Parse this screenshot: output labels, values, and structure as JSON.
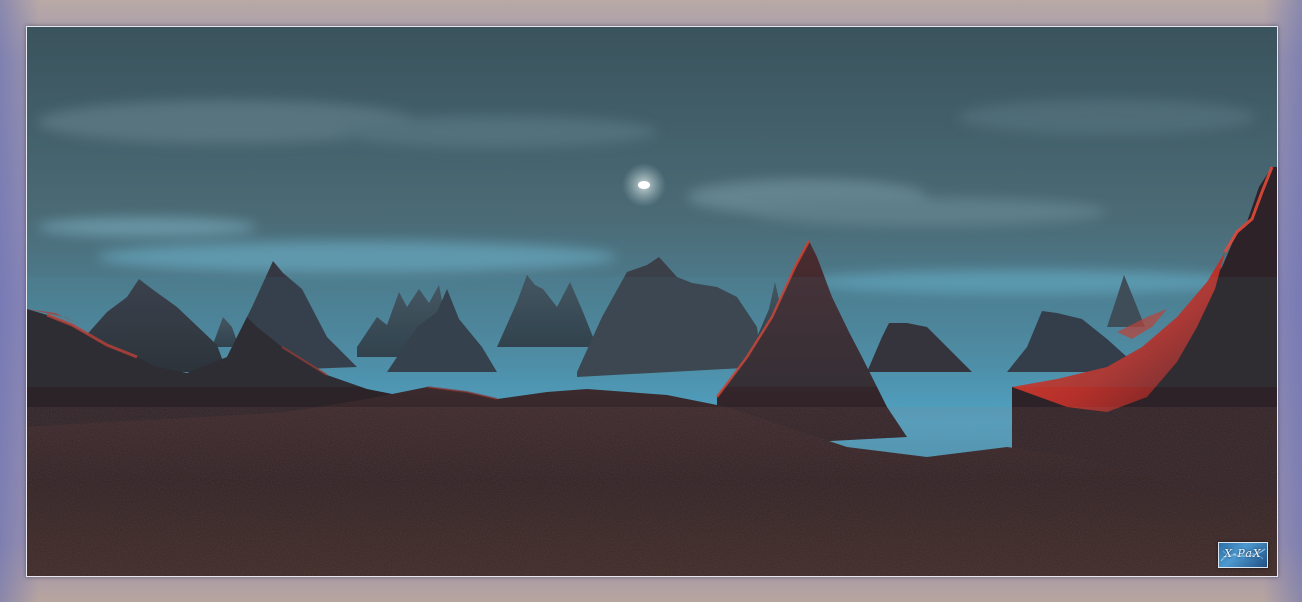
{
  "scene": {
    "colors": {
      "sky_top": "#3c5560",
      "sky_mid": "#4a6c78",
      "sky_horizon": "#4fa6c8",
      "mountain_dark": "#2a2228",
      "mountain_mid": "#3a3f4a",
      "lava_red": "#d83a2c",
      "ground": "#2e2224",
      "frame": "#8e89b6"
    }
  },
  "watermark": {
    "text": "X-PaX"
  }
}
